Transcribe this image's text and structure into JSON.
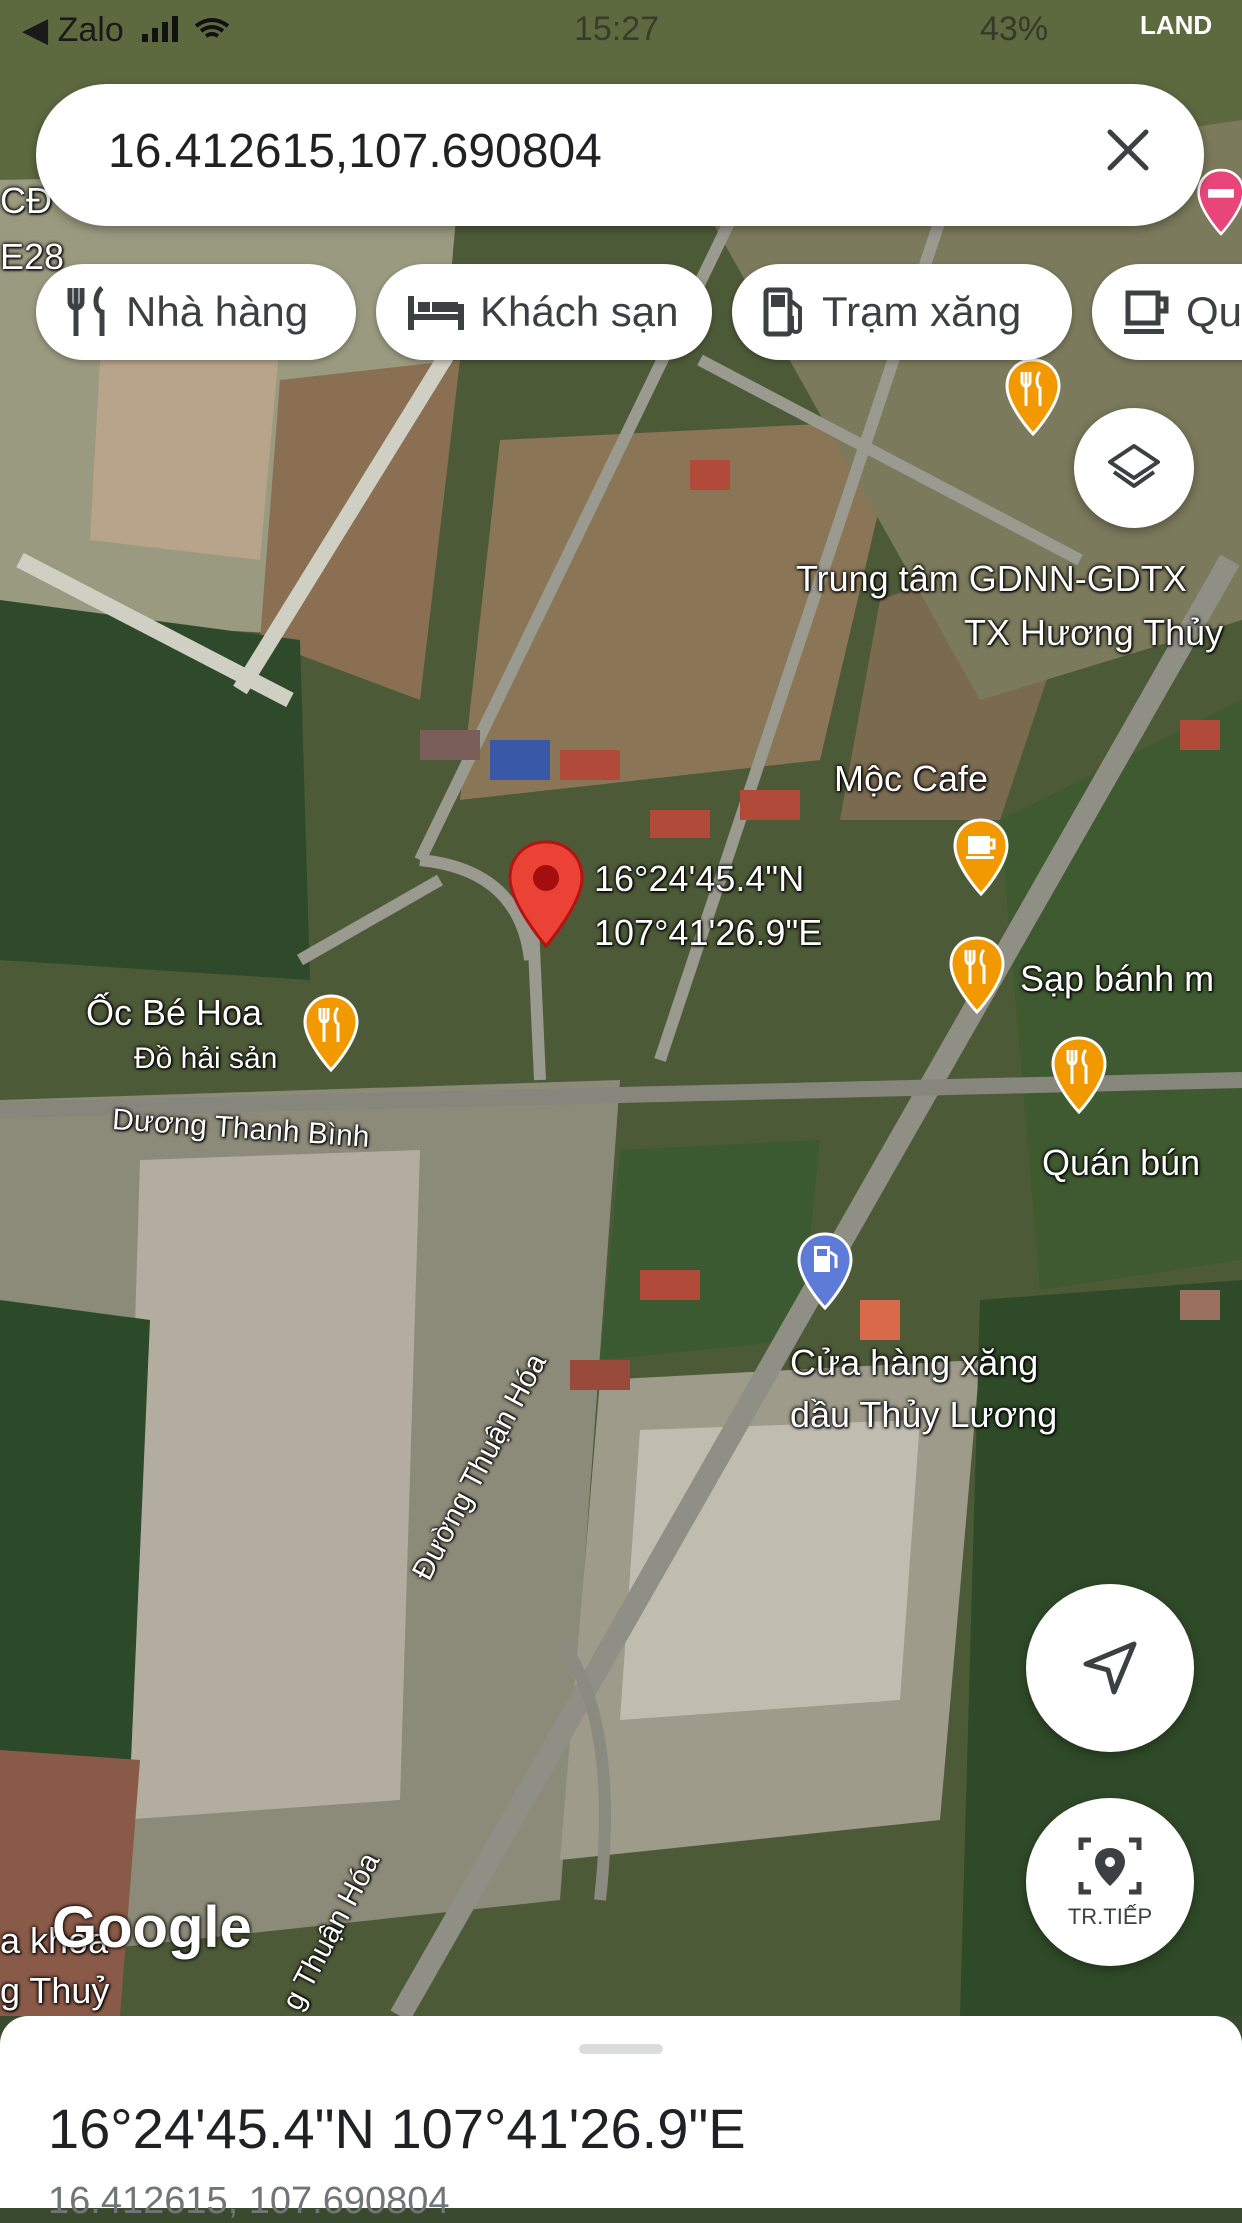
{
  "status_bar": {
    "back_app": "◀ Zalo",
    "time": "15:27",
    "battery": "43%",
    "carrier_logo": "LAND"
  },
  "search": {
    "query": "16.412615,107.690804"
  },
  "chips": [
    {
      "label": "Nhà hàng",
      "icon": "restaurant-icon"
    },
    {
      "label": "Khách sạn",
      "icon": "hotel-icon"
    },
    {
      "label": "Trạm xăng",
      "icon": "gas-station-icon"
    },
    {
      "label": "Qu",
      "icon": "coffee-icon"
    }
  ],
  "pin": {
    "lat_dms": "16°24'45.4\"N",
    "lon_dms": "107°41'26.9\"E"
  },
  "places": {
    "edge_top_1": "CĐ",
    "edge_top_2": "E28",
    "trung_tam_1": "Trung tâm GDNN-GDTX",
    "trung_tam_2": "TX Hương Thủy",
    "moc_cafe": "Mộc Cafe",
    "sap_banh": "Sạp bánh m",
    "oc_be_hoa": "Ốc Bé Hoa",
    "oc_be_hoa_sub": "Đồ hải sản",
    "quan_bun": "Quán bún",
    "cua_hang_1": "Cửa hàng xăng",
    "cua_hang_2": "dầu Thủy Lương",
    "edge_bottom_1": "a khoa",
    "edge_bottom_2": "g Thuỷ"
  },
  "roads": {
    "duong_thanh_binh": "Dương Thanh Bình",
    "duong_thuan_hoa": "Đường Thuận Hóa",
    "thuan_hoa_lower": "g Thuận Hóa"
  },
  "buttons": {
    "locate_label": "TR.TIẾP"
  },
  "watermark": "Google",
  "sheet": {
    "title": "16°24'45.4\"N 107°41'26.9\"E",
    "subtitle": "16.412615, 107.690804"
  },
  "colors": {
    "pin_red": "#ea4335",
    "poi_orange": "#f29900",
    "gas_blue": "#5e7bd8"
  }
}
